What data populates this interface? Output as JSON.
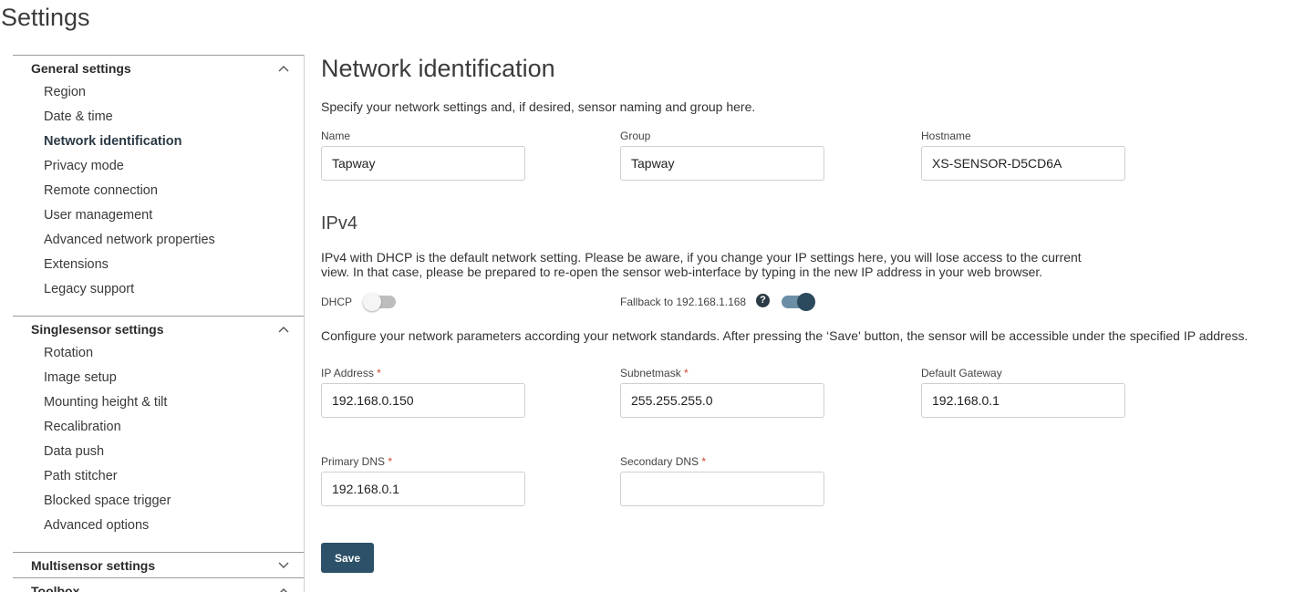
{
  "page": {
    "title": "Settings"
  },
  "sidebar": {
    "general": {
      "title": "General settings",
      "expanded": true,
      "items": [
        {
          "label": "Region"
        },
        {
          "label": "Date & time"
        },
        {
          "label": "Network identification",
          "active": true
        },
        {
          "label": "Privacy mode"
        },
        {
          "label": "Remote connection"
        },
        {
          "label": "User management"
        },
        {
          "label": "Advanced network properties"
        },
        {
          "label": "Extensions"
        },
        {
          "label": "Legacy support"
        }
      ]
    },
    "singlesensor": {
      "title": "Singlesensor settings",
      "expanded": true,
      "items": [
        {
          "label": "Rotation"
        },
        {
          "label": "Image setup"
        },
        {
          "label": "Mounting height & tilt"
        },
        {
          "label": "Recalibration"
        },
        {
          "label": "Data push"
        },
        {
          "label": "Path stitcher"
        },
        {
          "label": "Blocked space trigger"
        },
        {
          "label": "Advanced options"
        }
      ]
    },
    "multisensor": {
      "title": "Multisensor settings",
      "expanded": false
    },
    "toolbox": {
      "title": "Toolbox",
      "expanded": true
    }
  },
  "network": {
    "heading": "Network identification",
    "description": "Specify your network settings and, if desired, sensor naming and group here.",
    "name": {
      "label": "Name",
      "value": "Tapway"
    },
    "group": {
      "label": "Group",
      "value": "Tapway"
    },
    "hostname": {
      "label": "Hostname",
      "value": "XS-SENSOR-D5CD6A"
    }
  },
  "ipv4": {
    "heading": "IPv4",
    "notice_line1": "IPv4 with DHCP is the default network setting. Please be aware, if you change your IP settings here, you will lose access to the current",
    "notice_line2": "view. In that case, please be prepared to re-open the sensor web-interface by typing in the new IP address in your web browser.",
    "dhcp": {
      "label": "DHCP",
      "enabled": false
    },
    "fallback": {
      "label": "Fallback to 192.168.1.168",
      "enabled": true,
      "help_icon": "question-circle-icon"
    },
    "configure_text": "Configure your network parameters according your network standards. After pressing the ‘Save' button, the sensor will be accessible under the specified IP address.",
    "required_marker": "*",
    "ip_address": {
      "label": "IP Address",
      "value": "192.168.0.150",
      "required": true
    },
    "subnetmask": {
      "label": "Subnetmask",
      "value": "255.255.255.0",
      "required": true
    },
    "gateway": {
      "label": "Default Gateway",
      "value": "192.168.0.1",
      "required": false
    },
    "primary_dns": {
      "label": "Primary DNS",
      "value": "192.168.0.1",
      "required": true
    },
    "secondary_dns": {
      "label": "Secondary DNS",
      "value": "",
      "required": true
    }
  },
  "actions": {
    "save_label": "Save"
  },
  "colors": {
    "primary": "#2c5168",
    "toggle_on": "#2c4a5e",
    "required": "#d0442c"
  }
}
